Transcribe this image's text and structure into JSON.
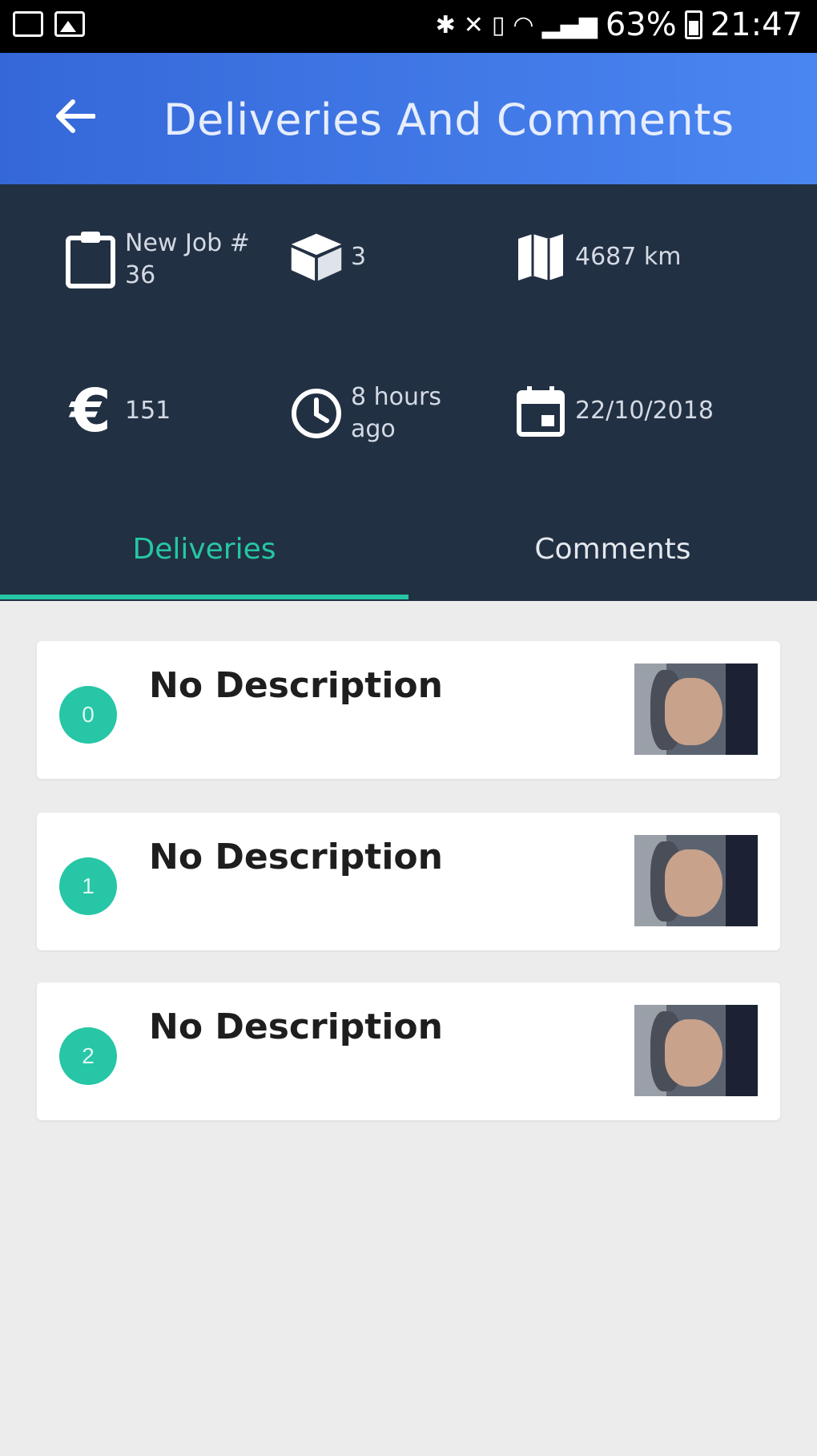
{
  "status_bar": {
    "battery": "63%",
    "time": "21:47"
  },
  "app_bar": {
    "title": "Deliveries And Comments"
  },
  "job_info": {
    "job_label": "New Job #",
    "job_number": "36",
    "packages": "3",
    "distance": "4687 km",
    "price": "151",
    "elapsed_line1": "8 hours",
    "elapsed_line2": "ago",
    "date": "22/10/2018"
  },
  "tabs": {
    "deliveries": "Deliveries",
    "comments": "Comments"
  },
  "deliveries": [
    {
      "index": "0",
      "description": "No Description"
    },
    {
      "index": "1",
      "description": "No Description"
    },
    {
      "index": "2",
      "description": "No Description"
    }
  ],
  "colors": {
    "accent": "#26c6a6",
    "app_bar_start": "#3567d8",
    "app_bar_end": "#4a86f2",
    "panel": "#223043",
    "background": "#ececec"
  }
}
